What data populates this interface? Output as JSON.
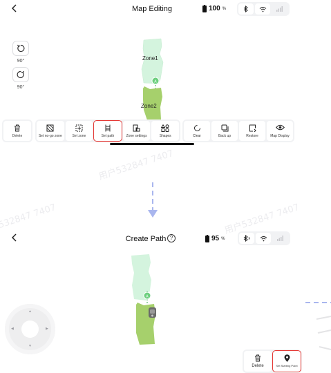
{
  "top": {
    "title": "Map Editing",
    "battery_value": "100",
    "battery_unit": "%",
    "battery_level": 1.0,
    "status_icons": [
      "bluetooth-icon",
      "wifi-icon",
      "cellular-signal-icon"
    ],
    "rotate_ccw_label": "90°",
    "rotate_cw_label": "90°",
    "zones": [
      {
        "name": "Zone1",
        "color": "#d4f4de"
      },
      {
        "name": "Zone2",
        "color": "#a6d06c"
      }
    ],
    "toolbar_groups": [
      [
        {
          "label": "Delete",
          "icon": "trash-icon",
          "glyph": "🗑"
        }
      ],
      [
        {
          "label": "Set no-go zone",
          "icon": "no-go-zone-icon",
          "glyph": "⊠"
        },
        {
          "label": "Set zone",
          "icon": "add-zone-icon",
          "glyph": "⊞"
        },
        {
          "label": "Set path",
          "icon": "path-icon",
          "glyph": "☷",
          "selected": true
        },
        {
          "label": "Zone settings",
          "icon": "zone-settings-icon",
          "glyph": "⧉"
        },
        {
          "label": "Shapes",
          "icon": "shapes-icon",
          "glyph": "⊡"
        }
      ],
      [
        {
          "label": "Clear",
          "icon": "clear-icon",
          "glyph": "◌"
        },
        {
          "label": "Back up",
          "icon": "backup-icon",
          "glyph": "❐"
        },
        {
          "label": "Restore",
          "icon": "restore-icon",
          "glyph": "⟲"
        },
        {
          "label": "Map Display",
          "icon": "eye-icon",
          "glyph": "◉"
        }
      ]
    ]
  },
  "watermarks": [
    "用户532847 7407",
    "532847 7407",
    "用户532847 7407"
  ],
  "bottom": {
    "title": "Create Path",
    "help_glyph": "?",
    "battery_value": "95",
    "battery_unit": "%",
    "battery_level": 0.95,
    "status_icons": [
      "bluetooth-icon",
      "wifi-icon",
      "cellular-signal-icon"
    ],
    "panel": [
      {
        "label": "Delete",
        "icon": "trash-icon",
        "glyph": "🗑"
      },
      {
        "label": "Set Starting Point",
        "icon": "location-pin-icon",
        "glyph": "⚲",
        "selected": true
      }
    ]
  },
  "colors": {
    "accent_red": "#e53935",
    "flow_arrow": "#a9b6ee",
    "zone_light": "#d4f4de",
    "zone_dark": "#a6d06c",
    "marker": "#6ccf7e"
  }
}
